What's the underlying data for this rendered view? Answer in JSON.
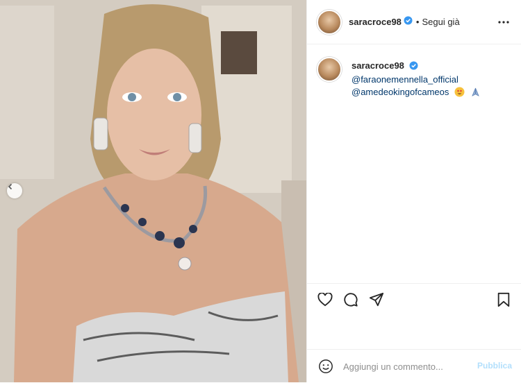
{
  "post": {
    "username": "saracroce98",
    "follow_status": "Segui già",
    "separator": "•"
  },
  "caption": {
    "username": "saracroce98",
    "mention_1": "@faraonemennella_official",
    "mention_2": "@amedeokingofcameos",
    "emojis": [
      "heart-eyes-emoji",
      "folded-hands-emoji"
    ]
  },
  "comment_box": {
    "placeholder": "Aggiungi un commento...",
    "post_label": "Pubblica"
  },
  "icons": {
    "verified": "verified-badge-icon",
    "more": "more-options-icon",
    "like": "heart-icon",
    "comment": "comment-icon",
    "share": "paper-plane-icon",
    "save": "bookmark-icon",
    "emoji": "smiley-icon",
    "carousel_prev": "chevron-left-icon"
  },
  "colors": {
    "verified_blue": "#3897f0",
    "mention_blue": "#00376b",
    "post_button_disabled": "#b2dffc",
    "divider": "#efefef"
  }
}
